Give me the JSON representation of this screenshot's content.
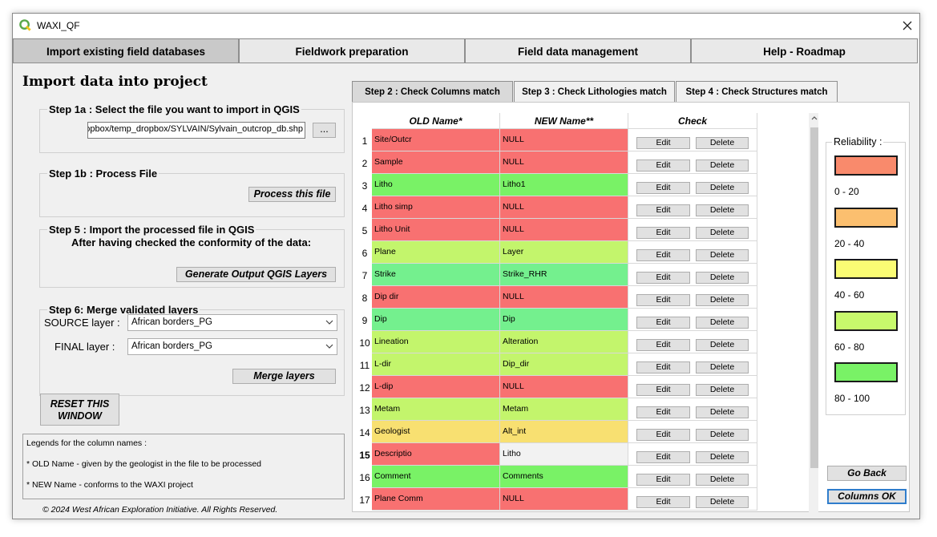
{
  "window": {
    "title": "WAXI_QF"
  },
  "main_tabs": [
    "Import existing field databases",
    "Fieldwork preparation",
    "Field data management",
    "Help - Roadmap"
  ],
  "left": {
    "heading": "Import data into project",
    "step1a": {
      "title": "Step 1a : Select the file you want to import in QGIS",
      "file_path": "opbox/temp_dropbox/SYLVAIN/Sylvain_outcrop_db.shp",
      "browse_label": "..."
    },
    "step1b": {
      "title": "Step 1b : Process File",
      "button": "Process this file"
    },
    "step5": {
      "title": "Step 5 : Import the processed file in QGIS",
      "text": "After having checked the conformity of the data:",
      "button": "Generate Output QGIS Layers"
    },
    "step6": {
      "title": "Step 6: Merge validated layers",
      "source_label": "SOURCE layer :",
      "source_value": "African borders_PG",
      "final_label": "FINAL layer :",
      "final_value": "African borders_PG",
      "button": "Merge layers"
    },
    "reset_button_line1": "RESET THIS",
    "reset_button_line2": "WINDOW",
    "legend": [
      "Legends for the column names :",
      "* OLD Name - given by the geologist in the file to be processed",
      "* NEW Name - conforms to the WAXI project"
    ],
    "copyright": "© 2024 West African Exploration Initiative. All Rights Reserved."
  },
  "sub_tabs": [
    "Step 2 : Check Columns match",
    "Step 3 : Check Lithologies match",
    "Step 4 : Check Structures match"
  ],
  "table": {
    "headers": [
      "OLD Name*",
      "NEW Name**",
      "Check"
    ],
    "edit_label": "Edit",
    "delete_label": "Delete",
    "rows": [
      {
        "num": "1",
        "old": "Site/Outcr",
        "new": "NULL",
        "old_color": "#f87171",
        "new_color": "#f87171"
      },
      {
        "num": "2",
        "old": "Sample",
        "new": "NULL",
        "old_color": "#f87171",
        "new_color": "#f87171"
      },
      {
        "num": "3",
        "old": "Litho",
        "new": "Litho1",
        "old_color": "#79f266",
        "new_color": "#79f266"
      },
      {
        "num": "4",
        "old": "Litho simp",
        "new": "NULL",
        "old_color": "#f87171",
        "new_color": "#f87171"
      },
      {
        "num": "5",
        "old": "Litho Unit",
        "new": "NULL",
        "old_color": "#f87171",
        "new_color": "#f87171"
      },
      {
        "num": "6",
        "old": "Plane",
        "new": "Layer",
        "old_color": "#c3f56c",
        "new_color": "#c3f56c"
      },
      {
        "num": "7",
        "old": "Strike",
        "new": "Strike_RHR",
        "old_color": "#74f08e",
        "new_color": "#74f08e"
      },
      {
        "num": "8",
        "old": "Dip dir",
        "new": "NULL",
        "old_color": "#f87171",
        "new_color": "#f87171"
      },
      {
        "num": "9",
        "old": "Dip",
        "new": "Dip",
        "old_color": "#74f08e",
        "new_color": "#74f08e"
      },
      {
        "num": "10",
        "old": "Lineation",
        "new": "Alteration",
        "old_color": "#c3f56c",
        "new_color": "#c3f56c"
      },
      {
        "num": "11",
        "old": "L-dir",
        "new": "Dip_dir",
        "old_color": "#c3f56c",
        "new_color": "#c3f56c"
      },
      {
        "num": "12",
        "old": "L-dip",
        "new": "NULL",
        "old_color": "#f87171",
        "new_color": "#f87171"
      },
      {
        "num": "13",
        "old": "Metam",
        "new": "Metam",
        "old_color": "#c3f56c",
        "new_color": "#c3f56c"
      },
      {
        "num": "14",
        "old": "Geologist",
        "new": "Alt_int",
        "old_color": "#f8e071",
        "new_color": "#f8e071"
      },
      {
        "num": "15",
        "old": "Descriptio",
        "new": "Litho",
        "old_color": "#f87171",
        "new_color": "#f2f2f2"
      },
      {
        "num": "16",
        "old": "Comment",
        "new": "Comments",
        "old_color": "#79f266",
        "new_color": "#79f266"
      },
      {
        "num": "17",
        "old": "Plane Comm",
        "new": "NULL",
        "old_color": "#f87171",
        "new_color": "#f87171"
      }
    ]
  },
  "reliability": {
    "title": "Reliability :",
    "items": [
      {
        "range": "0 - 20",
        "color": "#f98a6c"
      },
      {
        "range": "20 - 40",
        "color": "#fbbf6f"
      },
      {
        "range": "40 - 60",
        "color": "#fafc74"
      },
      {
        "range": "60 - 80",
        "color": "#c8f96c"
      },
      {
        "range": "80 - 100",
        "color": "#79f266"
      }
    ]
  },
  "buttons": {
    "go_back": "Go Back",
    "columns_ok": "Columns OK"
  }
}
